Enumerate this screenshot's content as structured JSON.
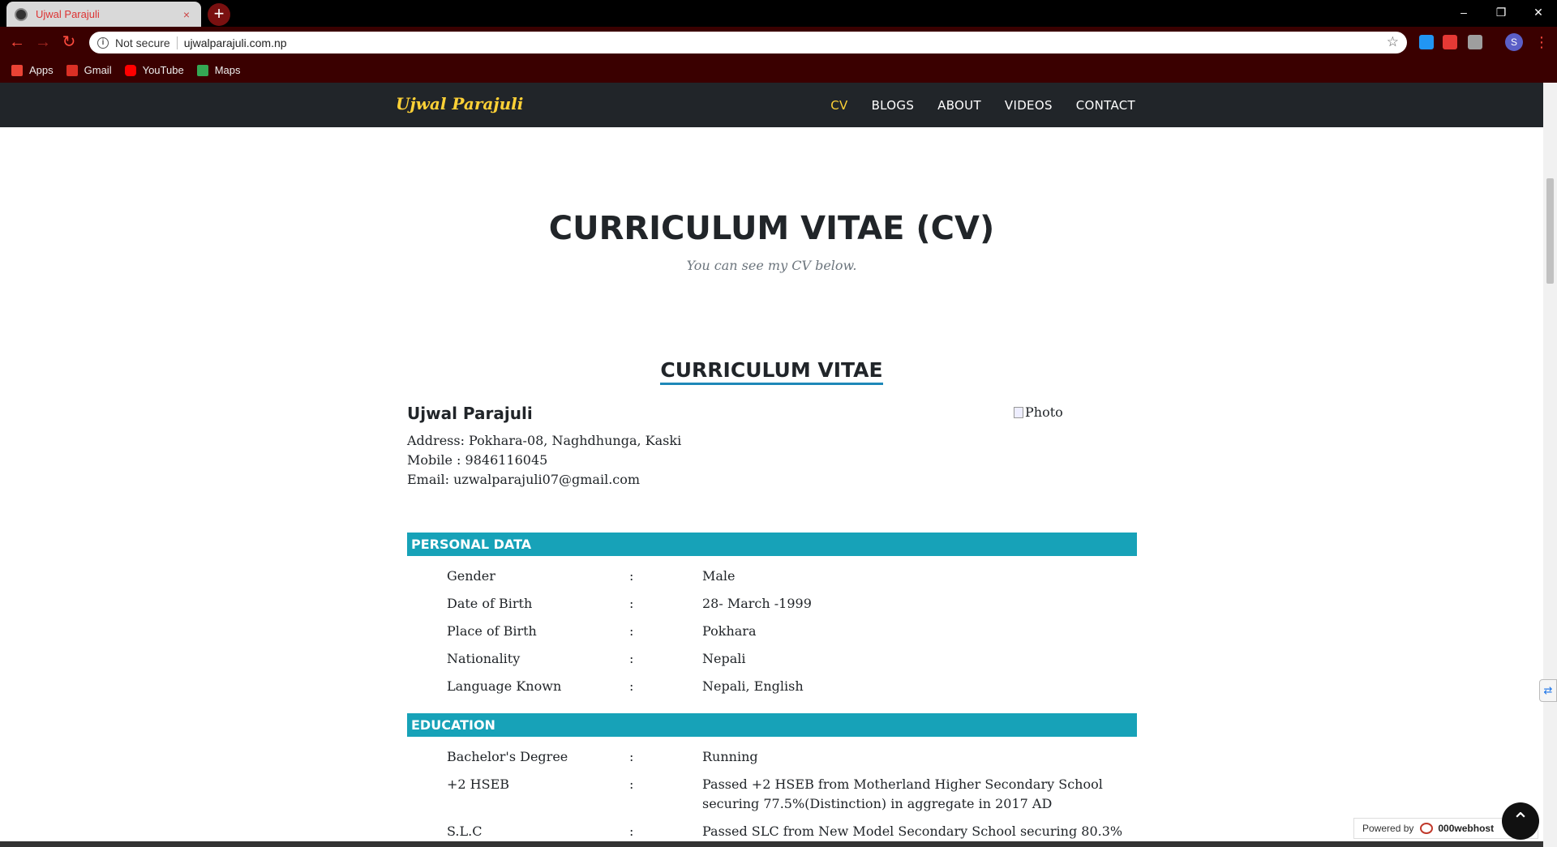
{
  "browser": {
    "tab_title": "Ujwal Parajuli",
    "tab_close": "×",
    "new_tab": "+",
    "window_controls": [
      "–",
      "❐",
      "✕"
    ],
    "security_label": "Not secure",
    "url": "ujwalparajuli.com.np",
    "bookmarks": [
      {
        "label": "Apps",
        "icon": "apps-grid-icon",
        "color": "#ea4335"
      },
      {
        "label": "Gmail",
        "icon": "gmail-icon",
        "color": "#d93025"
      },
      {
        "label": "YouTube",
        "icon": "youtube-icon",
        "color": "#ff0000"
      },
      {
        "label": "Maps",
        "icon": "maps-icon",
        "color": "#34a853"
      }
    ],
    "profile_initial": "S",
    "colors": {
      "toolbar": "#3a0000",
      "tabbar": "#000000",
      "accent": "#ff4b3e"
    }
  },
  "site": {
    "brand": "Ujwal Parajuli",
    "nav": [
      "CV",
      "BLOGS",
      "ABOUT",
      "VIDEOS",
      "CONTACT"
    ],
    "active_nav": "CV",
    "colors": {
      "navbar": "#212529",
      "brand": "#fed136",
      "section": "#17a2b8"
    }
  },
  "hero": {
    "title": "CURRICULUM VITAE (CV)",
    "subtitle": "You can see my CV below."
  },
  "cv": {
    "heading": "CURRICULUM VITAE",
    "name": "Ujwal Parajuli",
    "address": "Address: Pokhara-08, Naghdhunga, Kaski",
    "mobile": "Mobile : 9846116045",
    "email": "Email: uzwalparajuli07@gmail.com",
    "photo_alt": "Photo",
    "personal_title": "PERSONAL DATA",
    "personal": [
      {
        "key": "Gender",
        "sep": ":",
        "value": "Male"
      },
      {
        "key": "Date of Birth",
        "sep": ":",
        "value": "28- March -1999"
      },
      {
        "key": "Place of Birth",
        "sep": ":",
        "value": "Pokhara"
      },
      {
        "key": "Nationality",
        "sep": ":",
        "value": "Nepali"
      },
      {
        "key": "Language Known",
        "sep": ":",
        "value": "Nepali, English"
      }
    ],
    "education_title": "EDUCATION",
    "education": [
      {
        "key": "Bachelor's Degree",
        "sep": ":",
        "value": "Running"
      },
      {
        "key": "+2 HSEB",
        "sep": ":",
        "value": "Passed +2 HSEB from Motherland Higher Secondary School securing 77.5%(Distinction) in aggregate in 2017 AD"
      },
      {
        "key": "S.L.C",
        "sep": ":",
        "value": "Passed SLC from New Model Secondary School securing 80.3%"
      }
    ]
  },
  "footer": {
    "powered_by": "Powered by",
    "host": "000webhost",
    "back_to_top": "⌃"
  }
}
